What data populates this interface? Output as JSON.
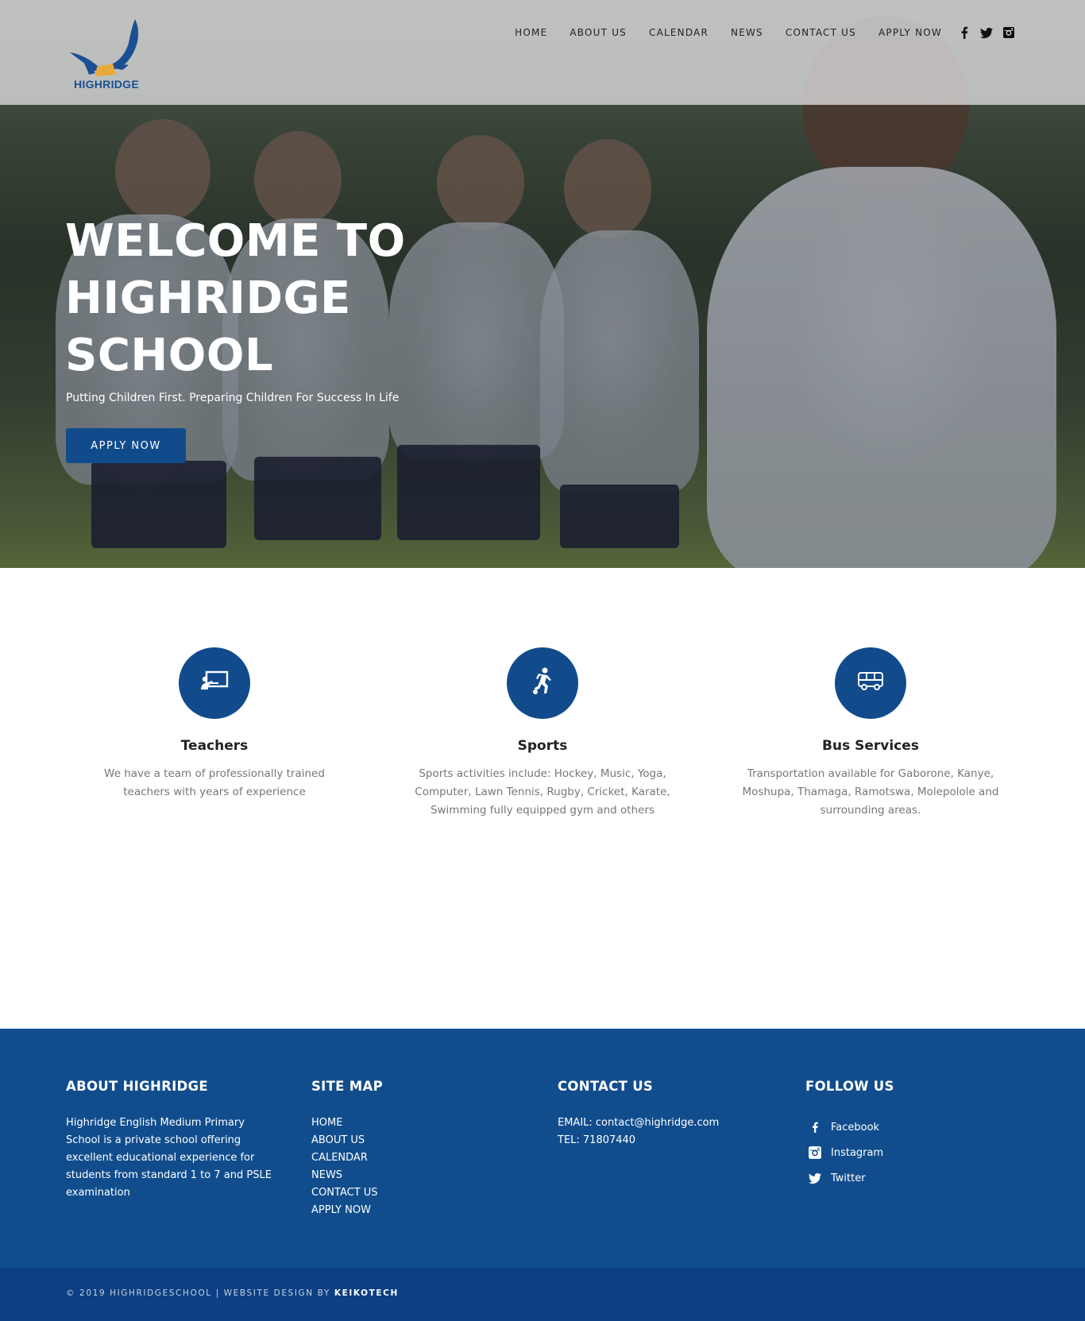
{
  "brand": {
    "logo_text": "HIGHRIDGE",
    "primary_color": "#124b8c"
  },
  "nav": {
    "items": [
      "HOME",
      "ABOUT US",
      "CALENDAR",
      "NEWS",
      "CONTACT US",
      "APPLY NOW"
    ],
    "social_icons": [
      "facebook-icon",
      "twitter-icon",
      "instagram-icon"
    ]
  },
  "hero": {
    "title_lines": [
      "WELCOME TO",
      "HIGHRIDGE",
      "SCHOOL"
    ],
    "subtitle": "Putting Children First. Preparing Children For Success In Life",
    "cta_label": "APPLY NOW"
  },
  "features": [
    {
      "icon": "teacher-board-icon",
      "title": "Teachers",
      "text": "We have a team of professionally trained teachers with years of experience"
    },
    {
      "icon": "soccer-player-icon",
      "title": "Sports",
      "text": "Sports activities include: Hockey, Music, Yoga, Computer, Lawn Tennis, Rugby, Cricket, Karate, Swimming fully equipped gym and others"
    },
    {
      "icon": "bus-icon",
      "title": "Bus Services",
      "text": "Transportation available for Gaborone, Kanye, Moshupa, Thamaga, Ramotswa, Molepolole and surrounding areas."
    }
  ],
  "footer": {
    "about": {
      "heading": "ABOUT HIGHRIDGE",
      "text": "Highridge English Medium Primary School is a private school offering excellent educational experience for students from standard 1 to 7 and PSLE examination"
    },
    "sitemap": {
      "heading": "SITE MAP",
      "links": [
        "HOME",
        "ABOUT US",
        "CALENDAR",
        "NEWS",
        "CONTACT US",
        "APPLY NOW"
      ]
    },
    "contact": {
      "heading": "CONTACT US",
      "email": "EMAIL: contact@highridge.com",
      "tel": "TEL: 71807440"
    },
    "follow": {
      "heading": "FOLLOW US",
      "items": [
        {
          "icon": "facebook-icon",
          "label": "Facebook"
        },
        {
          "icon": "instagram-icon",
          "label": "Instagram"
        },
        {
          "icon": "twitter-icon",
          "label": "Twitter"
        }
      ]
    },
    "copyright_prefix": "© 2019 HIGHRIDGESCHOOL | WEBSITE DESIGN BY",
    "copyright_brand": "KEIKOTECH"
  }
}
